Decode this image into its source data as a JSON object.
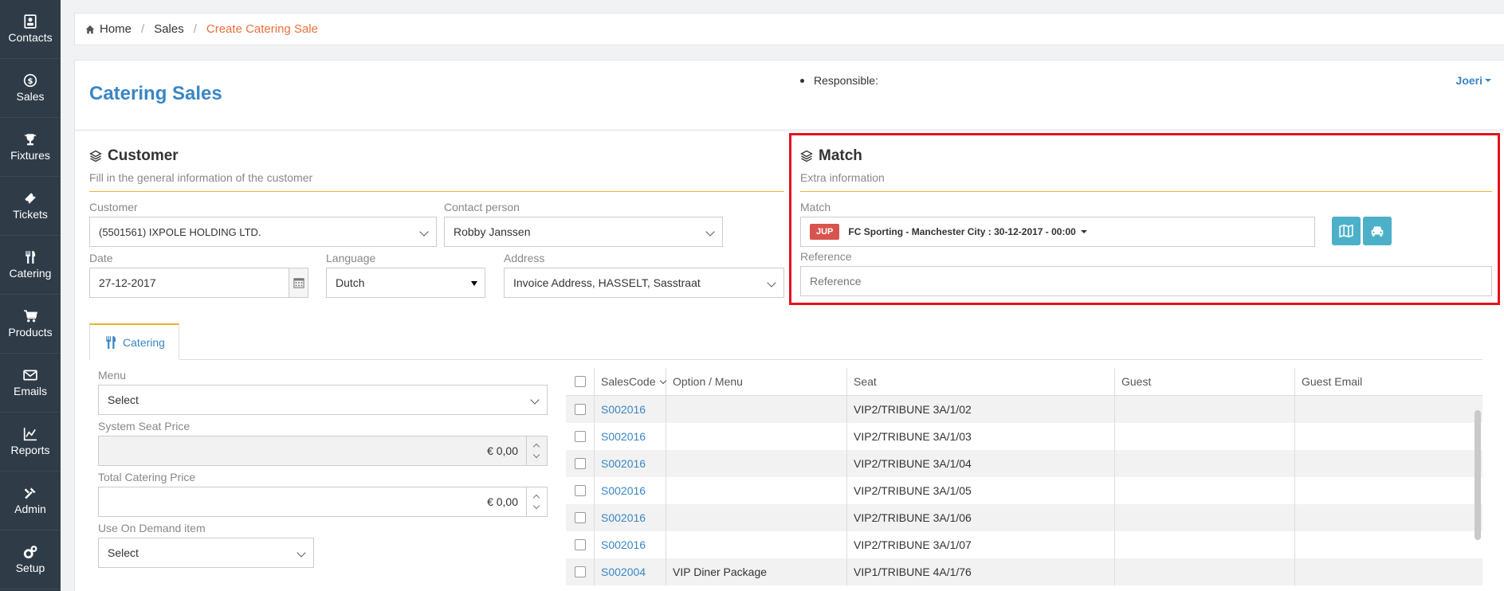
{
  "sidebar": {
    "items": [
      {
        "label": "Contacts",
        "icon": "contacts-icon"
      },
      {
        "label": "Sales",
        "icon": "dollar-icon"
      },
      {
        "label": "Fixtures",
        "icon": "trophy-icon"
      },
      {
        "label": "Tickets",
        "icon": "ticket-icon"
      },
      {
        "label": "Catering",
        "icon": "cutlery-icon"
      },
      {
        "label": "Products",
        "icon": "cart-icon"
      },
      {
        "label": "Emails",
        "icon": "envelope-icon"
      },
      {
        "label": "Reports",
        "icon": "chart-icon"
      },
      {
        "label": "Admin",
        "icon": "tools-icon"
      },
      {
        "label": "Setup",
        "icon": "gears-icon"
      }
    ]
  },
  "breadcrumb": {
    "home": "Home",
    "sales": "Sales",
    "current": "Create Catering Sale"
  },
  "header": {
    "title": "Catering Sales",
    "responsible_label": "Responsible:",
    "user": "Joeri"
  },
  "customer": {
    "heading": "Customer",
    "subtitle": "Fill in the general information of the customer",
    "customer_label": "Customer",
    "customer_value": "(5501561) IXPOLE HOLDING LTD.",
    "contact_label": "Contact person",
    "contact_value": "Robby Janssen",
    "date_label": "Date",
    "date_value": "27-12-2017",
    "language_label": "Language",
    "language_value": "Dutch",
    "address_label": "Address",
    "address_value": "Invoice Address, HASSELT, Sasstraat"
  },
  "match": {
    "heading": "Match",
    "subtitle": "Extra information",
    "match_label": "Match",
    "badge": "JUP",
    "match_value": "FC Sporting - Manchester City : 30-12-2017 - 00:00",
    "reference_label": "Reference",
    "reference_placeholder": "Reference"
  },
  "tabs": [
    {
      "label": "Catering"
    }
  ],
  "catering_form": {
    "menu_label": "Menu",
    "menu_value": "Select",
    "system_seat_price_label": "System Seat Price",
    "system_seat_price_value": "€ 0,00",
    "total_catering_price_label": "Total Catering Price",
    "total_catering_price_value": "€ 0,00",
    "on_demand_label": "Use On Demand item",
    "on_demand_value": "Select"
  },
  "table": {
    "headers": [
      "SalesCode",
      "Option / Menu",
      "Seat",
      "Guest",
      "Guest Email"
    ],
    "rows": [
      {
        "code": "S002016",
        "option": "",
        "seat": "VIP2/TRIBUNE 3A/1/02",
        "guest": "",
        "email": ""
      },
      {
        "code": "S002016",
        "option": "",
        "seat": "VIP2/TRIBUNE 3A/1/03",
        "guest": "",
        "email": ""
      },
      {
        "code": "S002016",
        "option": "",
        "seat": "VIP2/TRIBUNE 3A/1/04",
        "guest": "",
        "email": ""
      },
      {
        "code": "S002016",
        "option": "",
        "seat": "VIP2/TRIBUNE 3A/1/05",
        "guest": "",
        "email": ""
      },
      {
        "code": "S002016",
        "option": "",
        "seat": "VIP2/TRIBUNE 3A/1/06",
        "guest": "",
        "email": ""
      },
      {
        "code": "S002016",
        "option": "",
        "seat": "VIP2/TRIBUNE 3A/1/07",
        "guest": "",
        "email": ""
      },
      {
        "code": "S002004",
        "option": "VIP Diner Package",
        "seat": "VIP1/TRIBUNE 4A/1/76",
        "guest": "",
        "email": ""
      }
    ]
  },
  "colors": {
    "sidebar_bg": "#2f3c48",
    "accent_blue": "#3a86c4",
    "breadcrumb_active": "#e8703c",
    "gold_divider": "#e8b52a",
    "badge_red": "#d9534f",
    "button_teal": "#4cb0c9",
    "highlight_red": "#e3131c"
  }
}
